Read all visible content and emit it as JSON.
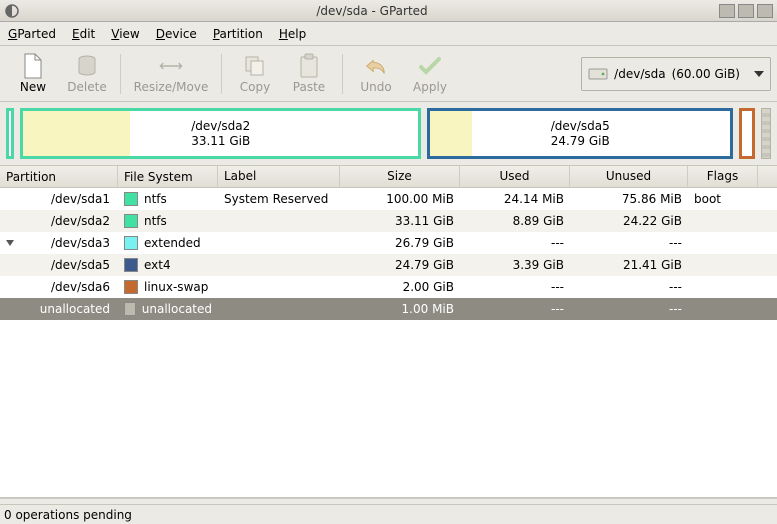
{
  "window": {
    "title": "/dev/sda - GParted"
  },
  "menu": {
    "gparted": "GParted",
    "edit": "Edit",
    "view": "View",
    "device": "Device",
    "partition": "Partition",
    "help": "Help"
  },
  "toolbar": {
    "new": "New",
    "delete": "Delete",
    "resize": "Resize/Move",
    "copy": "Copy",
    "paste": "Paste",
    "undo": "Undo",
    "apply": "Apply"
  },
  "device_selector": {
    "device": "/dev/sda",
    "size": "(60.00 GiB)"
  },
  "visual": {
    "p1": {
      "name": "/dev/sda2",
      "size": "33.11 GiB"
    },
    "p2": {
      "name": "/dev/sda5",
      "size": "24.79 GiB"
    }
  },
  "columns": {
    "partition": "Partition",
    "fs": "File System",
    "label": "Label",
    "size": "Size",
    "used": "Used",
    "unused": "Unused",
    "flags": "Flags"
  },
  "rows": [
    {
      "indent": 0,
      "expander": false,
      "partition": "/dev/sda1",
      "fs": "ntfs",
      "color": "#41e1a3",
      "label": "System Reserved",
      "size": "100.00 MiB",
      "used": "24.14 MiB",
      "unused": "75.86 MiB",
      "flags": "boot",
      "alt": false,
      "sel": false
    },
    {
      "indent": 0,
      "expander": false,
      "partition": "/dev/sda2",
      "fs": "ntfs",
      "color": "#41e1a3",
      "label": "",
      "size": "33.11 GiB",
      "used": "8.89 GiB",
      "unused": "24.22 GiB",
      "flags": "",
      "alt": true,
      "sel": false
    },
    {
      "indent": 0,
      "expander": true,
      "partition": "/dev/sda3",
      "fs": "extended",
      "color": "#77f1f1",
      "label": "",
      "size": "26.79 GiB",
      "used": "---",
      "unused": "---",
      "flags": "",
      "alt": false,
      "sel": false
    },
    {
      "indent": 1,
      "expander": false,
      "partition": "/dev/sda5",
      "fs": "ext4",
      "color": "#3d5a8f",
      "label": "",
      "size": "24.79 GiB",
      "used": "3.39 GiB",
      "unused": "21.41 GiB",
      "flags": "",
      "alt": true,
      "sel": false
    },
    {
      "indent": 1,
      "expander": false,
      "partition": "/dev/sda6",
      "fs": "linux-swap",
      "color": "#c46a2e",
      "label": "",
      "size": "2.00 GiB",
      "used": "---",
      "unused": "---",
      "flags": "",
      "alt": false,
      "sel": false
    },
    {
      "indent": 1,
      "expander": false,
      "partition": "unallocated",
      "fs": "unallocated",
      "color": "#bcb9af",
      "label": "",
      "size": "1.00 MiB",
      "used": "---",
      "unused": "---",
      "flags": "",
      "alt": false,
      "sel": true
    }
  ],
  "status": {
    "text": "0 operations pending"
  },
  "colors": {
    "ntfs": "#41e1a3",
    "ext4": "#3d5a8f",
    "swap": "#c46a2e",
    "extended": "#77f1f1"
  }
}
